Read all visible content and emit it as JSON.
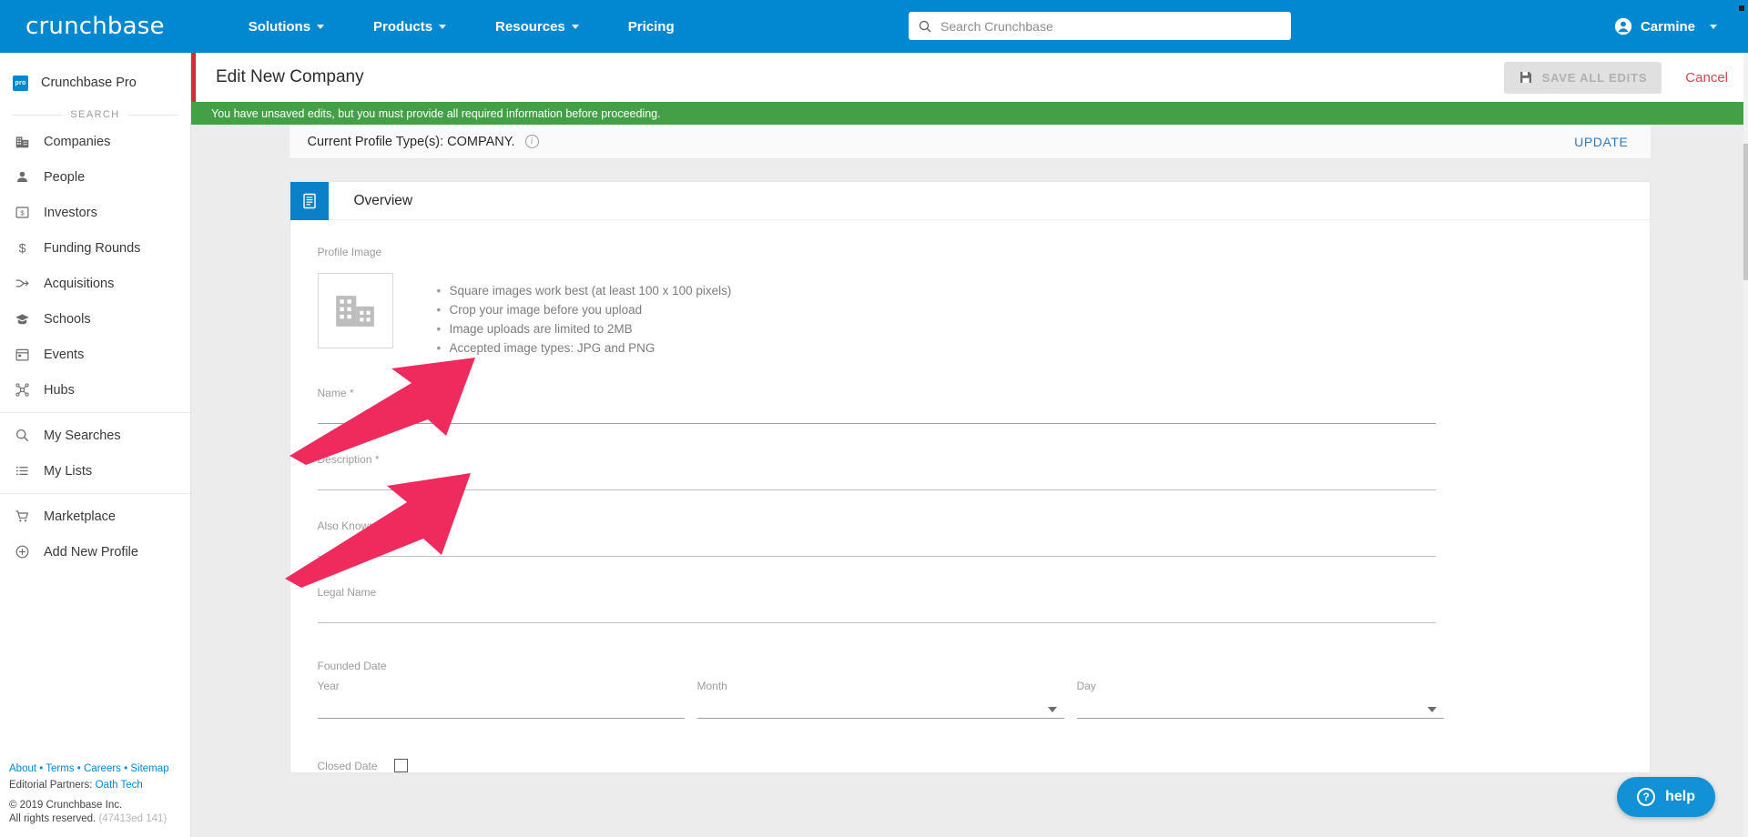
{
  "topnav": {
    "logo": "crunchbase",
    "links": [
      {
        "label": "Solutions",
        "caret": true
      },
      {
        "label": "Products",
        "caret": true
      },
      {
        "label": "Resources",
        "caret": true
      },
      {
        "label": "Pricing",
        "caret": false
      }
    ],
    "search_placeholder": "Search Crunchbase",
    "user_name": "Carmine",
    "brand_color": "#0288d1"
  },
  "sidebar": {
    "pro_label": "Crunchbase Pro",
    "pro_badge": "pro",
    "section_label": "SEARCH",
    "items": [
      {
        "label": "Companies",
        "icon": "building-icon"
      },
      {
        "label": "People",
        "icon": "person-icon"
      },
      {
        "label": "Investors",
        "icon": "dollar-box-icon"
      },
      {
        "label": "Funding Rounds",
        "icon": "dollar-icon"
      },
      {
        "label": "Acquisitions",
        "icon": "arrow-merge-icon"
      },
      {
        "label": "Schools",
        "icon": "graduation-cap-icon"
      },
      {
        "label": "Events",
        "icon": "calendar-icon"
      },
      {
        "label": "Hubs",
        "icon": "hubs-icon"
      }
    ],
    "items2": [
      {
        "label": "My Searches",
        "icon": "search-icon"
      },
      {
        "label": "My Lists",
        "icon": "list-icon"
      }
    ],
    "items3": [
      {
        "label": "Marketplace",
        "icon": "cart-icon"
      },
      {
        "label": "Add New Profile",
        "icon": "plus-circle-icon"
      }
    ]
  },
  "footer": {
    "links": [
      "About",
      "Terms",
      "Careers",
      "Sitemap"
    ],
    "separator": " • ",
    "editorial_prefix": "Editorial Partners: ",
    "editorial_partner": "Oath Tech",
    "copyright": "© 2019 Crunchbase Inc.",
    "rights": "All rights reserved.",
    "revision": "(47413ed 141)"
  },
  "header": {
    "title": "Edit New Company",
    "save_label": "SAVE ALL EDITS",
    "save_icon": "floppy-disk-icon",
    "cancel_label": "Cancel",
    "accent_color": "#d32f2f"
  },
  "alert": {
    "message": "You have unsaved edits, but you must provide all required information before proceeding.",
    "color": "#43a047"
  },
  "profile_type": {
    "text": "Current Profile Type(s): COMPANY.",
    "info_icon": "info-icon",
    "update_label": "UPDATE"
  },
  "overview": {
    "section_icon": "document-icon",
    "section_title": "Overview",
    "profile_image_label": "Profile Image",
    "placeholder_icon": "building-placeholder-icon",
    "tips": [
      "Square images work best (at least 100 x 100 pixels)",
      "Crop your image before you upload",
      "Image uploads are limited to 2MB",
      "Accepted image types: JPG and PNG"
    ],
    "fields": [
      {
        "label": "Name *",
        "value": "",
        "name": "name"
      },
      {
        "label": "Description *",
        "value": "",
        "name": "description"
      },
      {
        "label": "Also Known As",
        "value": "",
        "name": "also-known-as"
      },
      {
        "label": "Legal Name",
        "value": "",
        "name": "legal-name"
      }
    ],
    "founded_date": {
      "group_label": "Founded Date",
      "year_label": "Year",
      "month_label": "Month",
      "day_label": "Day",
      "year_value": "",
      "month_value": "",
      "day_value": ""
    },
    "closed_date": {
      "label": "Closed Date",
      "checked": false
    }
  },
  "help": {
    "label": "help",
    "icon": "question-circle-icon"
  },
  "annotations": {
    "arrow_color": "#ef2b5e",
    "arrows": [
      {
        "name": "arrow-to-profile-image"
      },
      {
        "name": "arrow-to-name-field"
      }
    ]
  }
}
